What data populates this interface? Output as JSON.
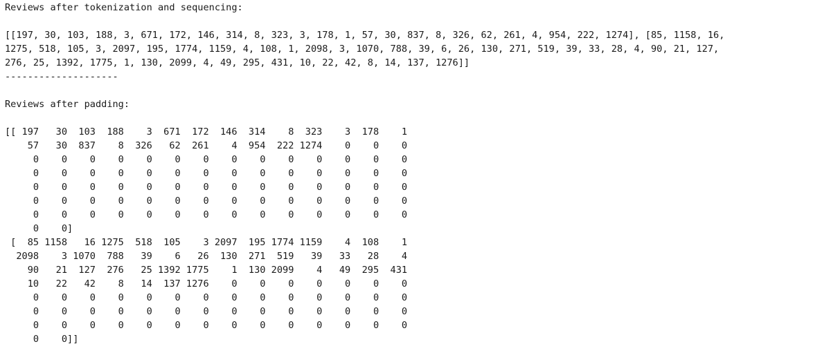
{
  "output": {
    "heading_sequences": "Reviews after tokenization and sequencing:",
    "sequences_lines": [
      "[[197, 30, 103, 188, 3, 671, 172, 146, 314, 8, 323, 3, 178, 1, 57, 30, 837, 8, 326, 62, 261, 4, 954, 222, 1274], [85, 1158, 16,",
      "1275, 518, 105, 3, 2097, 195, 1774, 1159, 4, 108, 1, 2098, 3, 1070, 788, 39, 6, 26, 130, 271, 519, 39, 33, 28, 4, 90, 21, 127,",
      "276, 25, 1392, 1775, 1, 130, 2099, 4, 49, 295, 431, 10, 22, 42, 8, 14, 137, 1276]]"
    ],
    "separator": "--------------------",
    "heading_padding": "Reviews after padding:",
    "padded_lines": [
      "[[ 197   30  103  188    3  671  172  146  314    8  323    3  178    1",
      "    57   30  837    8  326   62  261    4  954  222 1274    0    0    0",
      "     0    0    0    0    0    0    0    0    0    0    0    0    0    0",
      "     0    0    0    0    0    0    0    0    0    0    0    0    0    0",
      "     0    0    0    0    0    0    0    0    0    0    0    0    0    0",
      "     0    0    0    0    0    0    0    0    0    0    0    0    0    0",
      "     0    0    0    0    0    0    0    0    0    0    0    0    0    0",
      "     0    0]",
      " [  85 1158   16 1275  518  105    3 2097  195 1774 1159    4  108    1",
      "  2098    3 1070  788   39    6   26  130  271  519   39   33   28    4",
      "    90   21  127  276   25 1392 1775    1  130 2099    4   49  295  431",
      "    10   22   42    8   14  137 1276    0    0    0    0    0    0    0",
      "     0    0    0    0    0    0    0    0    0    0    0    0    0    0",
      "     0    0    0    0    0    0    0    0    0    0    0    0    0    0",
      "     0    0    0    0    0    0    0    0    0    0    0    0    0    0",
      "     0    0]]"
    ]
  }
}
